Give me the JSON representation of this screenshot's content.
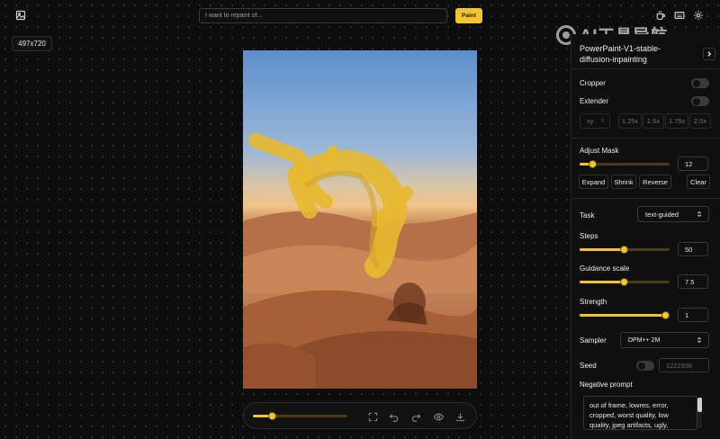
{
  "header": {
    "image_icon": "image-icon",
    "prompt_placeholder": "I want to repaint of...",
    "paint_label": "Paint",
    "right_icons": [
      "coffee-icon",
      "keyboard-icon",
      "settings-icon"
    ]
  },
  "canvas": {
    "size_label": "497x720",
    "zoom_level": 0.2
  },
  "watermark": "AI工具导航",
  "toolbar": {
    "icons": [
      "fit-screen-icon",
      "undo-icon",
      "redo-icon",
      "eye-icon",
      "download-icon"
    ]
  },
  "panel": {
    "model_name": "PowerPaint-V1-stable-diffusion-inpainting",
    "cropper_label": "Cropper",
    "extender_label": "Extender",
    "extender_direction": "xy",
    "extender_scales": [
      "1.25x",
      "1.5x",
      "1.75x",
      "2.0x"
    ],
    "adjust_mask_label": "Adjust Mask",
    "adjust_mask_value": "12",
    "mask_buttons": [
      "Expand",
      "Shrink",
      "Reverse",
      "Clear"
    ],
    "task_label": "Task",
    "task_value": "text-guided",
    "steps_label": "Steps",
    "steps_value": "50",
    "guidance_label": "Guidance scale",
    "guidance_value": "7.5",
    "strength_label": "Strength",
    "strength_value": "1",
    "sampler_label": "Sampler",
    "sampler_value": "DPM++ 2M",
    "seed_label": "Seed",
    "seed_value": "1222936",
    "negative_prompt_label": "Negative prompt",
    "negative_prompt_value": "out of frame, lowres, error, cropped, worst quality, low quality, jpeg artifacts, ugly,"
  },
  "colors": {
    "accent": "#f4c430",
    "background": "#0d0d0d",
    "panel": "#0f0f0f"
  }
}
